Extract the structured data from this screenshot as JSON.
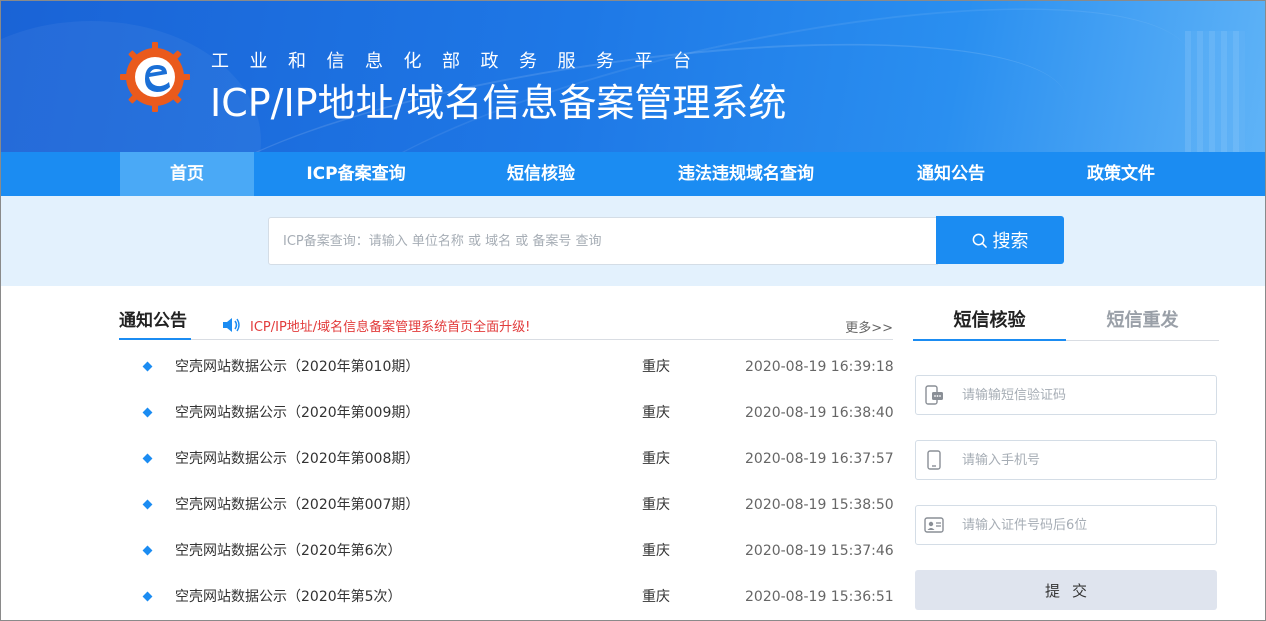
{
  "header": {
    "subtitle": "工业和信息化部政务服务平台",
    "title": "ICP/IP地址/域名信息备案管理系统"
  },
  "nav": {
    "items": [
      {
        "label": "首页",
        "active": true
      },
      {
        "label": "ICP备案查询",
        "active": false
      },
      {
        "label": "短信核验",
        "active": false
      },
      {
        "label": "违法违规域名查询",
        "active": false
      },
      {
        "label": "通知公告",
        "active": false
      },
      {
        "label": "政策文件",
        "active": false
      }
    ]
  },
  "search": {
    "placeholder": "ICP备案查询：请输入 单位名称 或 域名 或 备案号 查询",
    "button_label": "搜索"
  },
  "notices": {
    "tab_label": "通知公告",
    "marquee": "ICP/IP地址/域名信息备案管理系统首页全面升级!",
    "more_label": "更多>>",
    "items": [
      {
        "title": "空壳网站数据公示（2020年第010期）",
        "region": "重庆",
        "date": "2020-08-19 16:39:18"
      },
      {
        "title": "空壳网站数据公示（2020年第009期）",
        "region": "重庆",
        "date": "2020-08-19 16:38:40"
      },
      {
        "title": "空壳网站数据公示（2020年第008期）",
        "region": "重庆",
        "date": "2020-08-19 16:37:57"
      },
      {
        "title": "空壳网站数据公示（2020年第007期）",
        "region": "重庆",
        "date": "2020-08-19 15:38:50"
      },
      {
        "title": "空壳网站数据公示（2020年第6次）",
        "region": "重庆",
        "date": "2020-08-19 15:37:46"
      },
      {
        "title": "空壳网站数据公示（2020年第5次）",
        "region": "重庆",
        "date": "2020-08-19 15:36:51"
      }
    ]
  },
  "sms": {
    "tabs": [
      {
        "label": "短信核验",
        "active": true
      },
      {
        "label": "短信重发",
        "active": false
      }
    ],
    "code_placeholder": "请输输短信验证码",
    "phone_placeholder": "请输入手机号",
    "id_placeholder": "请输入证件号码后6位",
    "submit_label": "提交"
  },
  "colors": {
    "primary": "#1b8cf2",
    "nav_active": "#4aa9f6",
    "search_band": "#e3f1fd",
    "marquee_red": "#e23b3b"
  }
}
